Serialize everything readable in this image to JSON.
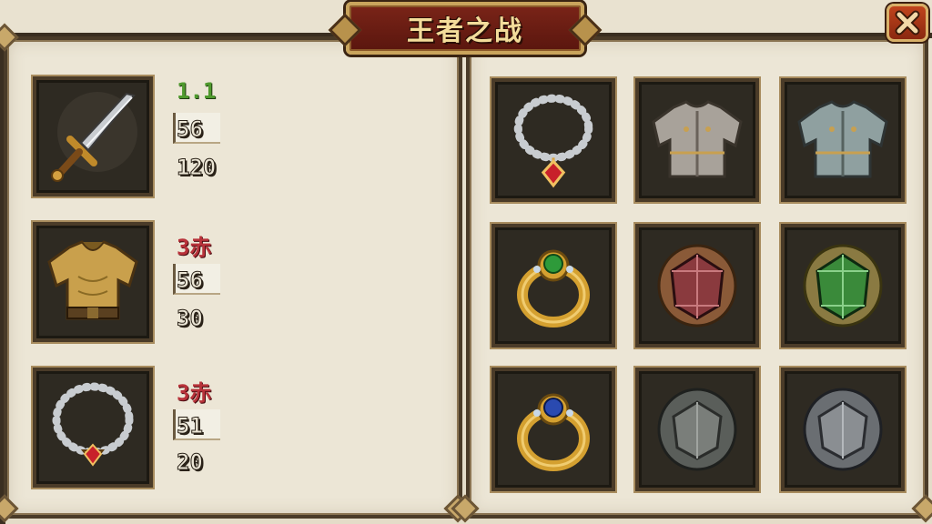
{
  "window": {
    "title": "王者之战"
  },
  "close_button": {
    "icon": "close-icon"
  },
  "equipped": [
    {
      "item": "sword-icon",
      "level": "1.1",
      "stat1": "56",
      "stat2": "120",
      "level_color": "#4f9a2e"
    },
    {
      "item": "armor-icon",
      "level": "3赤",
      "stat1": "56",
      "stat2": "30",
      "level_color": "#b8323a"
    },
    {
      "item": "necklace-icon",
      "level": "3赤",
      "stat1": "51",
      "stat2": "20",
      "level_color": "#b8323a"
    }
  ],
  "inventory": [
    "necklace-icon",
    "iron-armor-icon",
    "steel-armor-icon",
    "emerald-ring-icon",
    "ruby-shield-gem-icon",
    "emerald-shield-gem-icon",
    "sapphire-ring-icon",
    "stone-shield-icon",
    "iron-shield-icon"
  ]
}
